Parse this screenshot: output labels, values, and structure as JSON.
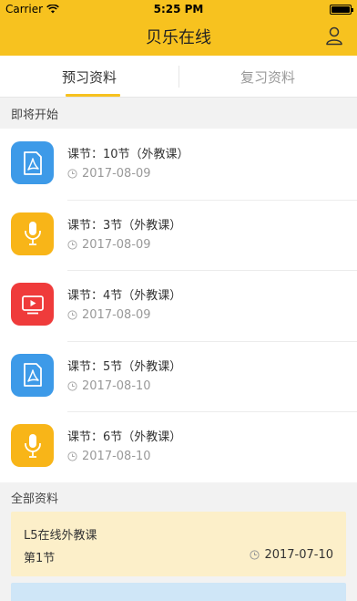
{
  "status_bar": {
    "carrier": "Carrier",
    "time": "5:25 PM"
  },
  "header": {
    "title": "贝乐在线"
  },
  "tabs": [
    {
      "label": "预习资料",
      "active": true
    },
    {
      "label": "复习资料",
      "active": false
    }
  ],
  "upcoming": {
    "heading": "即将开始",
    "items": [
      {
        "title": "课节：10节（外教课）",
        "date": "2017-08-09",
        "type": "pdf",
        "color": "#3d9ae8"
      },
      {
        "title": "课节：3节（外教课）",
        "date": "2017-08-09",
        "type": "audio",
        "color": "#f8b518"
      },
      {
        "title": "课节：4节（外教课）",
        "date": "2017-08-09",
        "type": "video",
        "color": "#ef3b3b"
      },
      {
        "title": "课节：5节（外教课）",
        "date": "2017-08-10",
        "type": "pdf",
        "color": "#3d9ae8"
      },
      {
        "title": "课节：6节（外教课）",
        "date": "2017-08-10",
        "type": "audio",
        "color": "#f8b518"
      }
    ]
  },
  "all": {
    "heading": "全部资料",
    "cards": [
      {
        "title": "L5在线外教课",
        "lesson": "第1节",
        "date": "2017-07-10"
      }
    ]
  }
}
